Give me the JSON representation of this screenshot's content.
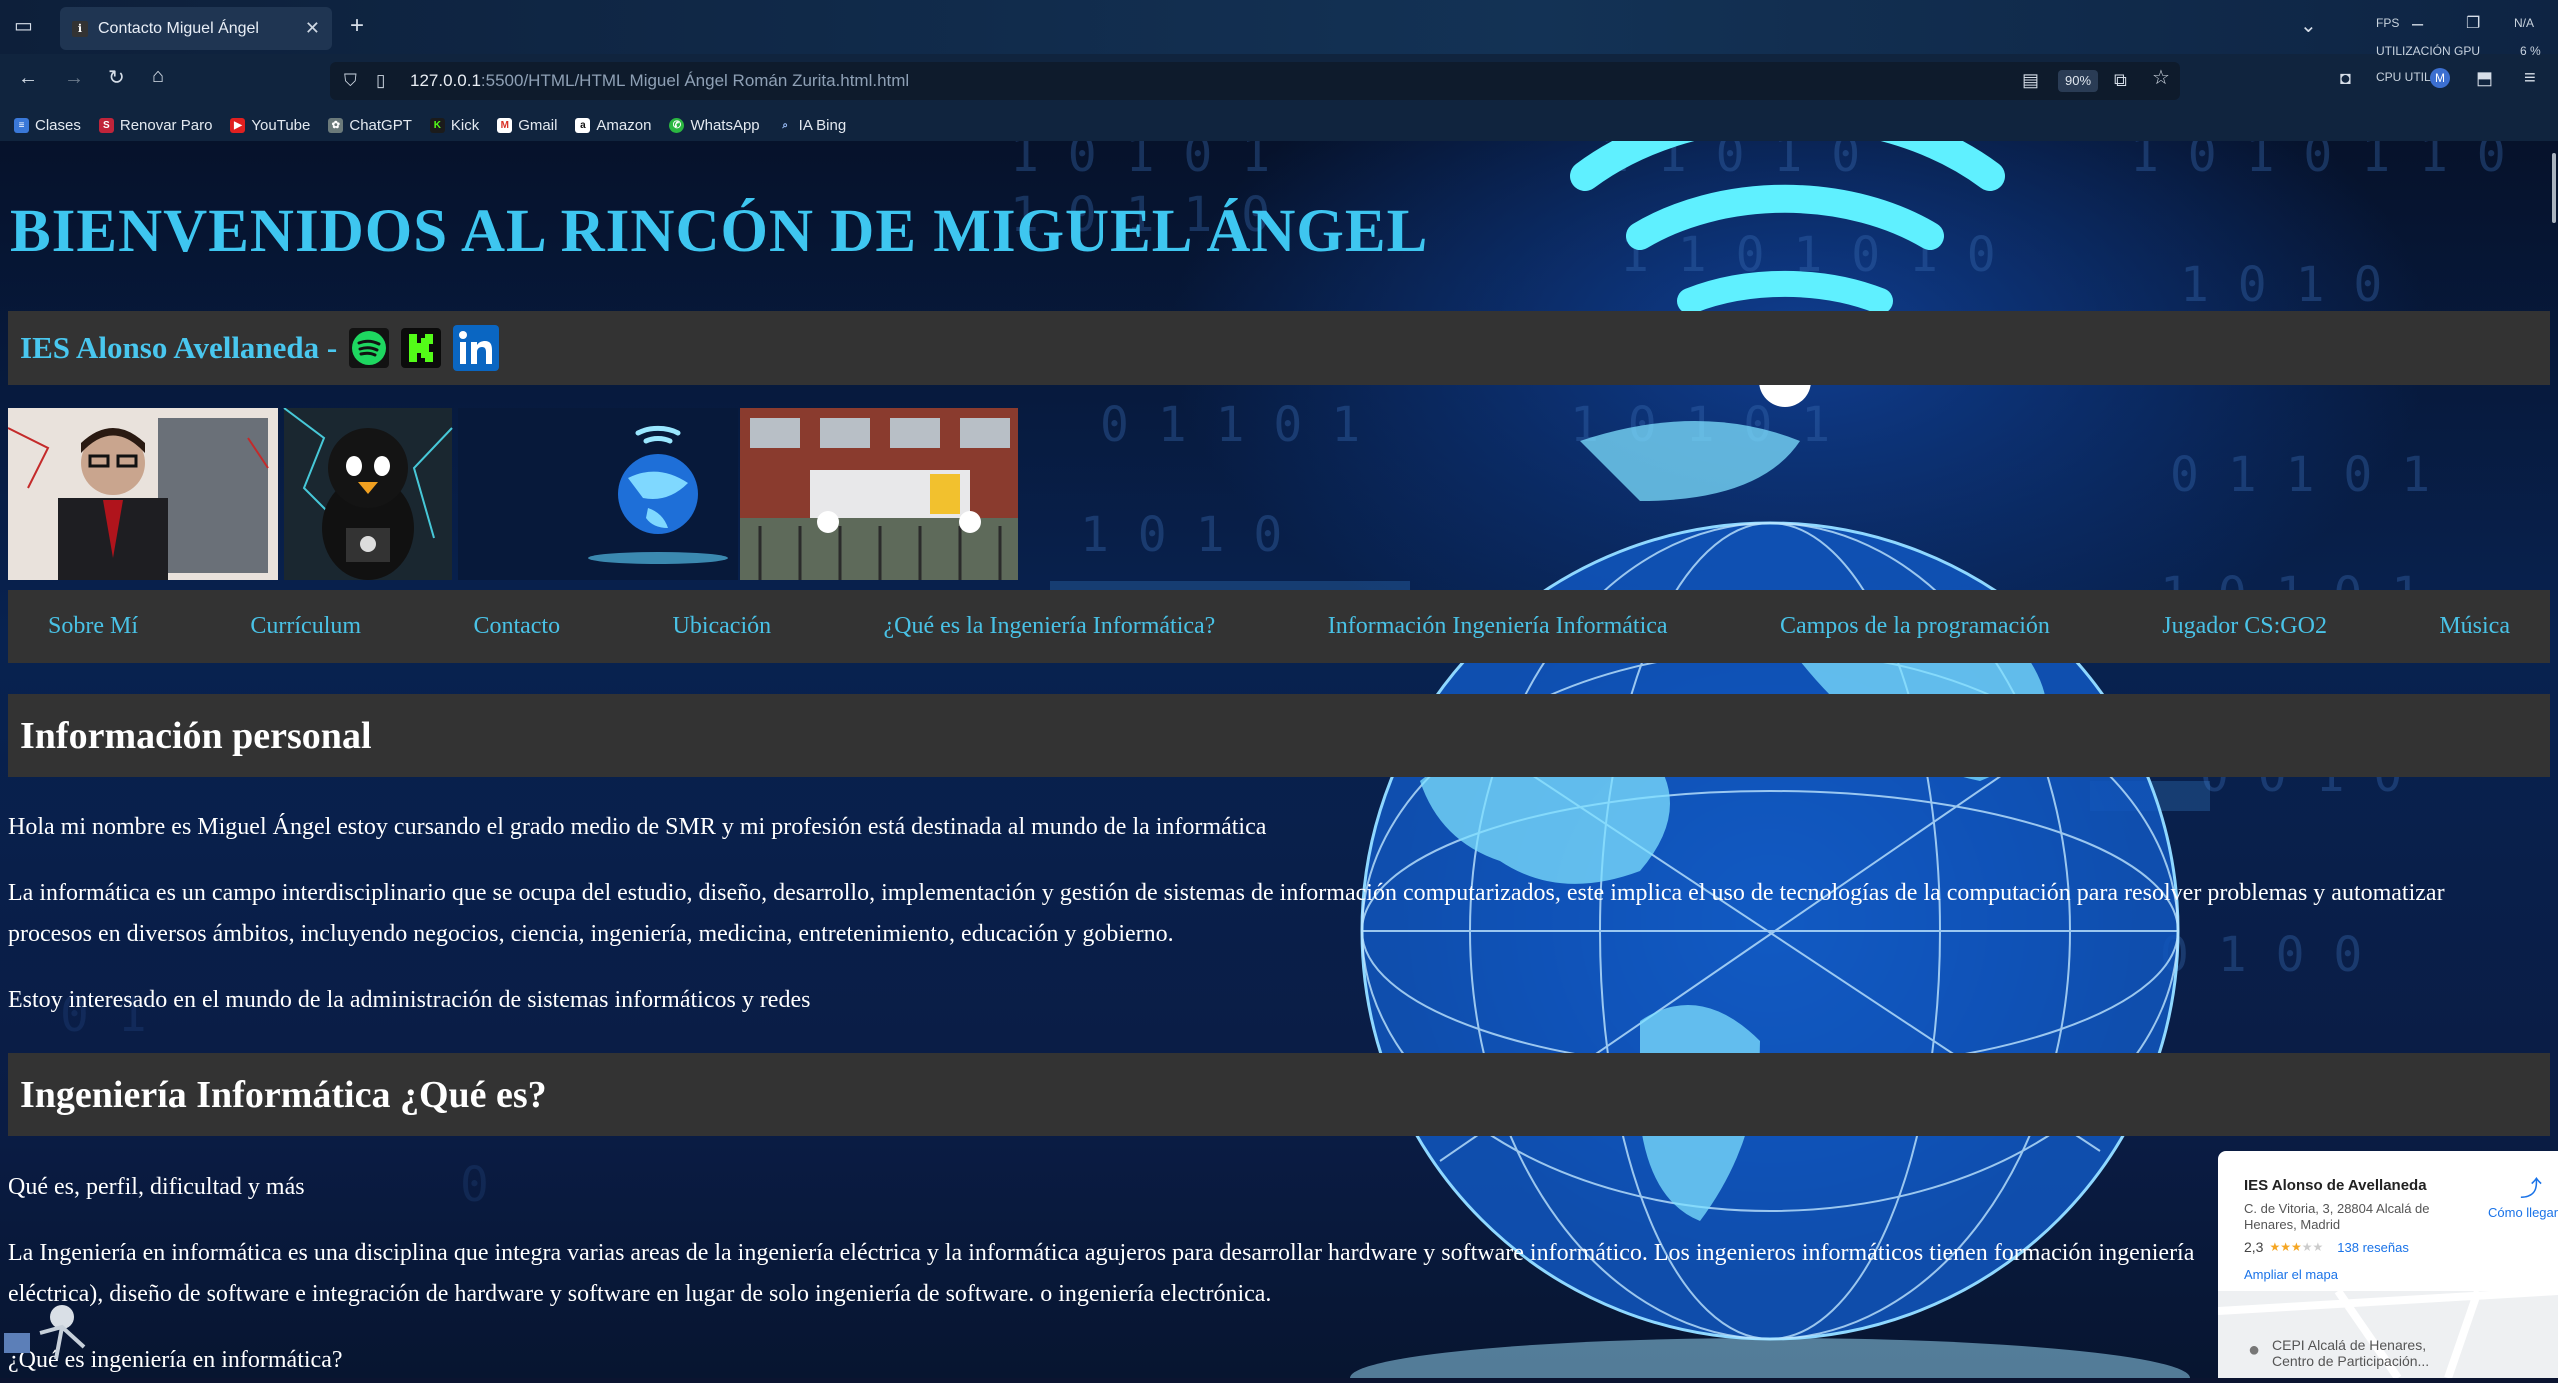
{
  "browser": {
    "tab_title": "Contacto Miguel Ángel",
    "url_host": "127.0.0.1",
    "url_path": ":5500/HTML/HTML Miguel Ángel Román Zurita.html.html",
    "zoom": "90%",
    "sys_fps": "FPS",
    "sys_na": "N/A",
    "sys_gpu_label": "UTILIZACIÓN GPU",
    "sys_gpu_value": "6 %",
    "sys_cpu_label": "CPU UTIL",
    "bookmarks": [
      "Clases",
      "Renovar Paro",
      "YouTube",
      "ChatGPT",
      "Kick",
      "Gmail",
      "Amazon",
      "WhatsApp",
      "IA Bing"
    ]
  },
  "page": {
    "title": "BIENVENIDOS AL RINCÓN DE MIGUEL ÁNGEL",
    "school": "IES Alonso Avellaneda -",
    "nav": [
      "Sobre Mí",
      "Currículum",
      "Contacto",
      "Ubicación",
      "¿Qué es la Ingeniería Informática?",
      "Información Ingeniería Informática",
      "Campos de la programación",
      "Jugador CS:GO2",
      "Música"
    ],
    "sections": {
      "personal_heading": "Información personal",
      "p1": "Hola mi nombre es Miguel Ángel estoy cursando el grado medio de SMR y mi profesión está destinada al mundo de la informática",
      "p2": "La informática es un campo interdisciplinario que se ocupa del estudio, diseño, desarrollo, implementación y gestión de sistemas de información computarizados, este implica el uso de tecnologías de la computación para resolver problemas y automatizar procesos en diversos ámbitos, incluyendo negocios, ciencia, ingeniería, medicina, entretenimiento, educación y gobierno.",
      "p3": "Estoy interesado en el mundo de la administración de sistemas informáticos y redes",
      "eng_heading": "Ingeniería Informática ¿Qué es?",
      "p4": "Qué es, perfil, dificultad y más",
      "p5": "La Ingeniería en informática es una disciplina que integra varias areas de la ingeniería eléctrica y la informática agujeros para desarrollar hardware y software informático. Los ingenieros informáticos tienen formación ingeniería eléctrica), diseño de software e integración de hardware y software en lugar de solo ingeniería de software. o ingeniería electrónica.",
      "p6": "¿Qué es ingeniería en informática?"
    },
    "map": {
      "name": "IES Alonso de Avellaneda",
      "address": "C. de Vitoria, 3, 28804 Alcalá de Henares, Madrid",
      "rating": "2,3",
      "reviews": "138 reseñas",
      "enlarge": "Ampliar el mapa",
      "directions": "Cómo llegar",
      "place": "CEPI Alcalá de Henares, Centro de Participación..."
    }
  },
  "colors": {
    "title": "#3ec6f0",
    "nav_link": "#49c2e6",
    "bar_bg": "#333333"
  }
}
